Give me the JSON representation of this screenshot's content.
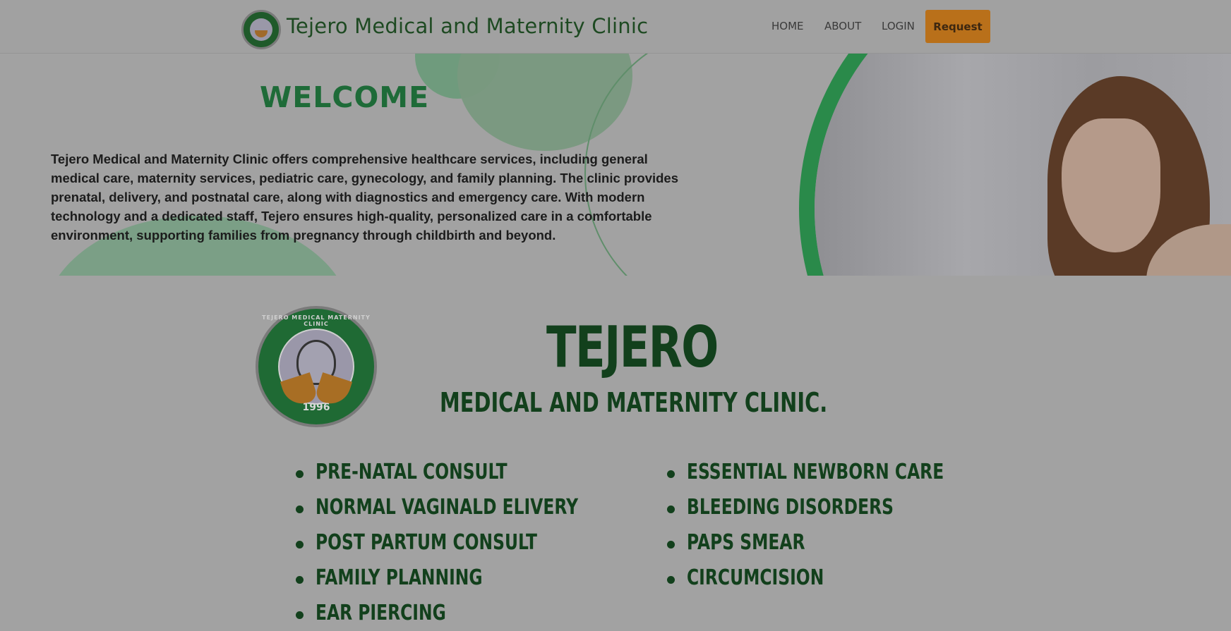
{
  "navbar": {
    "brand": "Tejero Medical and Maternity Clinic",
    "links": [
      "HOME",
      "ABOUT",
      "LOGIN"
    ],
    "request_label": "Request"
  },
  "hero": {
    "heading": "WELCOME",
    "description": "Tejero Medical and Maternity Clinic offers comprehensive healthcare services, including general medical care, maternity services, pediatric care, gynecology, and family planning. The clinic provides prenatal, delivery, and postnatal care, along with diagnostics and emergency care. With modern technology and a dedicated staff, Tejero ensures high-quality, personalized care in a comfortable environment, supporting families from pregnancy through childbirth and beyond."
  },
  "clinic": {
    "logo_text": "TEJERO MEDICAL MATERNITY CLINIC",
    "logo_year": "1996",
    "title": "TEJERO",
    "subtitle": "MEDICAL AND MATERNITY CLINIC.",
    "services_left": [
      "PRE-NATAL CONSULT",
      "NORMAL VAGINALD ELIVERY",
      "POST PARTUM CONSULT",
      "FAMILY PLANNING",
      "EAR PIERCING"
    ],
    "services_right": [
      "ESSENTIAL NEWBORN CARE",
      "BLEEDING DISORDERS",
      "PAPS SMEAR",
      "CIRCUMCISION"
    ]
  },
  "colors": {
    "brand_green": "#1e4a22",
    "accent_orange": "#b9701a",
    "overlay_gray": "#a2a2a2"
  }
}
